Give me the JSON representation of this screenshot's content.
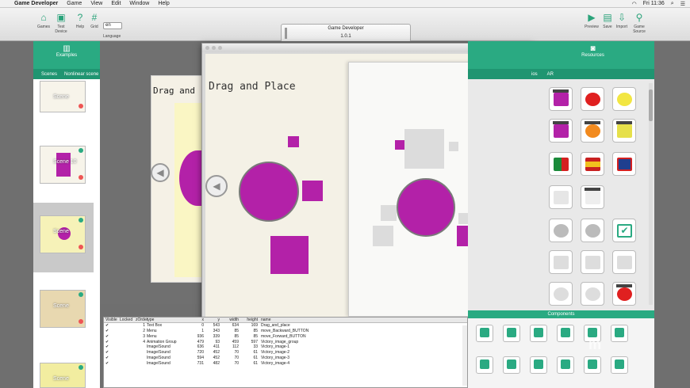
{
  "menubar": {
    "app": "Game Developer",
    "items": [
      "Game",
      "View",
      "Edit",
      "Window",
      "Help"
    ],
    "clock": "Fri 11:36"
  },
  "toolbar": {
    "buttons_left": [
      "Games",
      "Test Device",
      "Help",
      "Grid"
    ],
    "language_value": "en",
    "language_label": "Language",
    "buttons_right": [
      "Preview",
      "Save",
      "Import",
      "Game Source"
    ]
  },
  "titlebox": {
    "title": "Game Developer",
    "version": "1.0.1"
  },
  "left_panel": {
    "heading": "Examples",
    "tabs": [
      "Scenes",
      "Nonlinear scene"
    ],
    "thumbs": [
      "Scene",
      "Scene 10",
      "Scene",
      "Scene",
      "Scene"
    ]
  },
  "page": {
    "title": "Drag and Place",
    "ghost_title": "Drag and"
  },
  "right_panel": {
    "heading": "Resources",
    "tabs": [
      "ios",
      "AR"
    ]
  },
  "components": {
    "heading": "Components"
  },
  "table": {
    "headers": [
      "Visible",
      "Locked",
      "zOrder",
      "type",
      "x",
      "y",
      "width",
      "height",
      "name"
    ],
    "rows": [
      [
        "✔",
        "",
        "1",
        "Text Box",
        "0",
        "543",
        "634",
        "169",
        "Drag_and_place"
      ],
      [
        "✔",
        "",
        "2",
        "Menu",
        "1",
        "343",
        "85",
        "85",
        "move_Backward_BUTTON"
      ],
      [
        "✔",
        "",
        "3",
        "Menu",
        "936",
        "339",
        "85",
        "85",
        "move_Forward_BUTTON"
      ],
      [
        "✔",
        "",
        "4",
        "Animation Group",
        "479",
        "93",
        "459",
        "597",
        "Victory_image_group"
      ],
      [
        "✔",
        "",
        "",
        "Image/Sound",
        "636",
        "411",
        "112",
        "33",
        "Victory_image-1"
      ],
      [
        "✔",
        "",
        "",
        "Image/Sound",
        "720",
        "452",
        "70",
        "61",
        "Victory_image-2"
      ],
      [
        "✔",
        "",
        "",
        "Image/Sound",
        "594",
        "452",
        "70",
        "61",
        "Victory_image-3"
      ],
      [
        "✔",
        "",
        "",
        "Image/Sound",
        "731",
        "482",
        "70",
        "61",
        "Victory_image-4"
      ]
    ]
  },
  "colors": {
    "accent": "#2aaa82",
    "magenta": "#b321a8"
  }
}
